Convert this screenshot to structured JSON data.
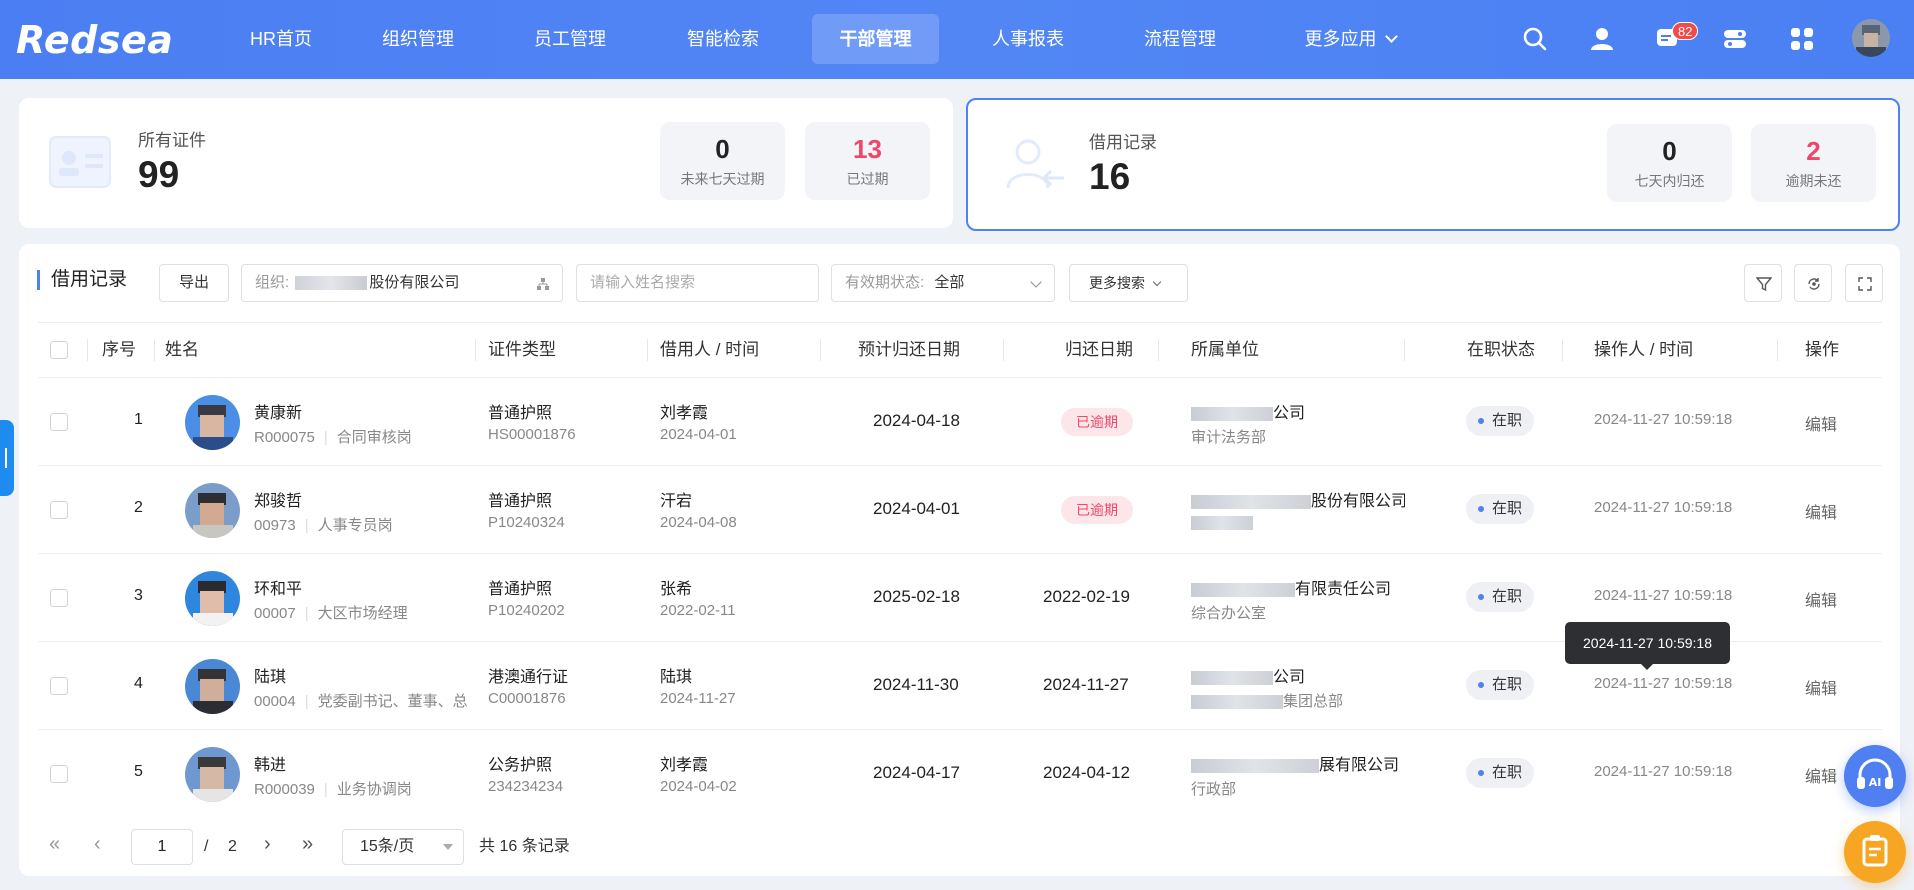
{
  "app": {
    "logo": "Redsea"
  },
  "nav": {
    "items": [
      {
        "label": "HR首页"
      },
      {
        "label": "组织管理"
      },
      {
        "label": "员工管理"
      },
      {
        "label": "智能检索"
      },
      {
        "label": "干部管理"
      },
      {
        "label": "人事报表"
      },
      {
        "label": "流程管理"
      },
      {
        "label": "更多应用"
      }
    ],
    "active": "干部管理",
    "message_badge": "82"
  },
  "summary": {
    "certs": {
      "label": "所有证件",
      "count": "99",
      "stats": [
        {
          "value": "0",
          "label": "未来七天过期"
        },
        {
          "value": "13",
          "label": "已过期"
        }
      ]
    },
    "borrow": {
      "label": "借用记录",
      "count": "16",
      "stats": [
        {
          "value": "0",
          "label": "七天内归还"
        },
        {
          "value": "2",
          "label": "逾期未还"
        }
      ]
    }
  },
  "toolbar": {
    "title": "借用记录",
    "export_label": "导出",
    "org_prefix": "组织:",
    "org_value": "股份有限公司",
    "name_placeholder": "请输入姓名搜索",
    "validity_prefix": "有效期状态:",
    "validity_value": "全部",
    "more_search_label": "更多搜索"
  },
  "table": {
    "columns": [
      "序号",
      "姓名",
      "证件类型",
      "借用人 / 时间",
      "预计归还日期",
      "归还日期",
      "所属单位",
      "在职状态",
      "操作人 / 时间",
      "操作"
    ],
    "rows": [
      {
        "index": "1",
        "name": "黄康新",
        "emp_no": "R000075",
        "post": "合同审核岗",
        "cert_type": "普通护照",
        "cert_no": "HS00001876",
        "borrower": "刘孝霞",
        "borrow_date": "2024-04-01",
        "expected_return": "2024-04-18",
        "return_date": "",
        "status_tag": "已逾期",
        "unit": "公司",
        "dept": "审计法务部",
        "employment": "在职",
        "op_time": "2024-11-27 10:59:18",
        "action": "编辑"
      },
      {
        "index": "2",
        "name": "郑骏哲",
        "emp_no": "00973",
        "post": "人事专员岗",
        "cert_type": "普通护照",
        "cert_no": "P10240324",
        "borrower": "汗宕",
        "borrow_date": "2024-04-08",
        "expected_return": "2024-04-01",
        "return_date": "",
        "status_tag": "已逾期",
        "unit": "股份有限公司",
        "dept": "",
        "employment": "在职",
        "op_time": "2024-11-27 10:59:18",
        "action": "编辑"
      },
      {
        "index": "3",
        "name": "环和平",
        "emp_no": "00007",
        "post": "大区市场经理",
        "cert_type": "普通护照",
        "cert_no": "P10240202",
        "borrower": "张希",
        "borrow_date": "2022-02-11",
        "expected_return": "2025-02-18",
        "return_date": "2022-02-19",
        "status_tag": "",
        "unit": "有限责任公司",
        "dept": "综合办公室",
        "employment": "在职",
        "op_time": "2024-11-27 10:59:18",
        "action": "编辑"
      },
      {
        "index": "4",
        "name": "陆琪",
        "emp_no": "00004",
        "post": "党委副书记、董事、总",
        "cert_type": "港澳通行证",
        "cert_no": "C00001876",
        "borrower": "陆琪",
        "borrow_date": "2024-11-27",
        "expected_return": "2024-11-30",
        "return_date": "2024-11-27",
        "status_tag": "",
        "unit": "公司",
        "dept": "集团总部",
        "employment": "在职",
        "op_time": "2024-11-27 10:59:18",
        "action": "编辑"
      },
      {
        "index": "5",
        "name": "韩进",
        "emp_no": "R000039",
        "post": "业务协调岗",
        "cert_type": "公务护照",
        "cert_no": "234234234",
        "borrower": "刘孝霞",
        "borrow_date": "2024-04-02",
        "expected_return": "2024-04-17",
        "return_date": "2024-04-12",
        "status_tag": "",
        "unit": "展有限公司",
        "dept": "行政部",
        "employment": "在职",
        "op_time": "2024-11-27 10:59:18",
        "action": "编辑"
      }
    ]
  },
  "tooltip": {
    "text": "2024-11-27 10:59:18"
  },
  "pagination": {
    "current": "1",
    "separator": "/",
    "total_pages": "2",
    "page_size": "15条/页",
    "total_text": "共 16 条记录"
  },
  "colors": {
    "brand": "#4d82f3",
    "danger": "#ef4669",
    "ai_fab": "#4f7ff0",
    "orange_fab": "#f6a623"
  }
}
